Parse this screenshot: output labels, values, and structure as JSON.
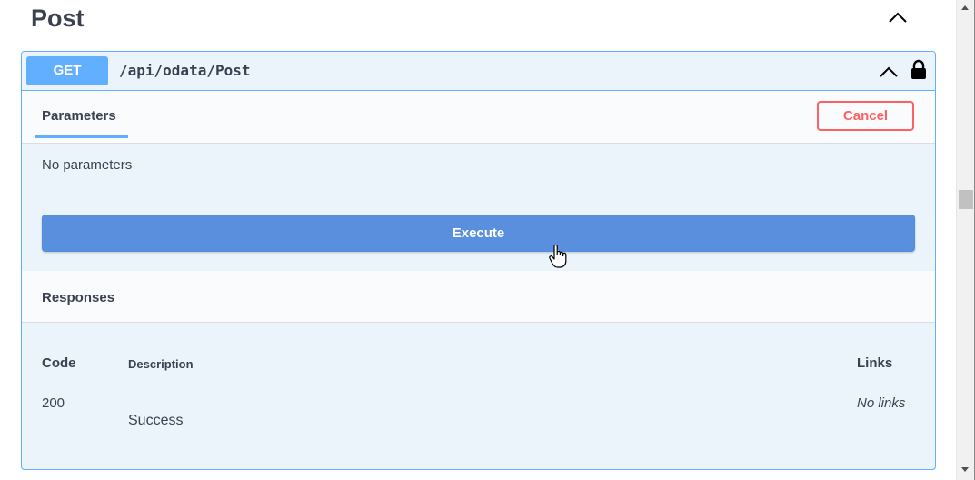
{
  "section": {
    "title": "Post",
    "toggle_icon": "chevron-up-icon"
  },
  "operation": {
    "method": "GET",
    "path": "/api/odata/Post",
    "toggle_icon": "chevron-up-icon",
    "lock_icon": "lock-icon",
    "accent_color": "#61affe"
  },
  "parameters": {
    "tab_label": "Parameters",
    "cancel_label": "Cancel",
    "empty_text": "No parameters",
    "execute_label": "Execute"
  },
  "responses": {
    "title": "Responses",
    "columns": {
      "code": "Code",
      "description": "Description",
      "links": "Links"
    },
    "rows": [
      {
        "code": "200",
        "description": "Success",
        "links": "No links"
      }
    ]
  },
  "colors": {
    "execute": "#5a8fde",
    "cancel": "#ff6060",
    "text": "#3b4151"
  }
}
